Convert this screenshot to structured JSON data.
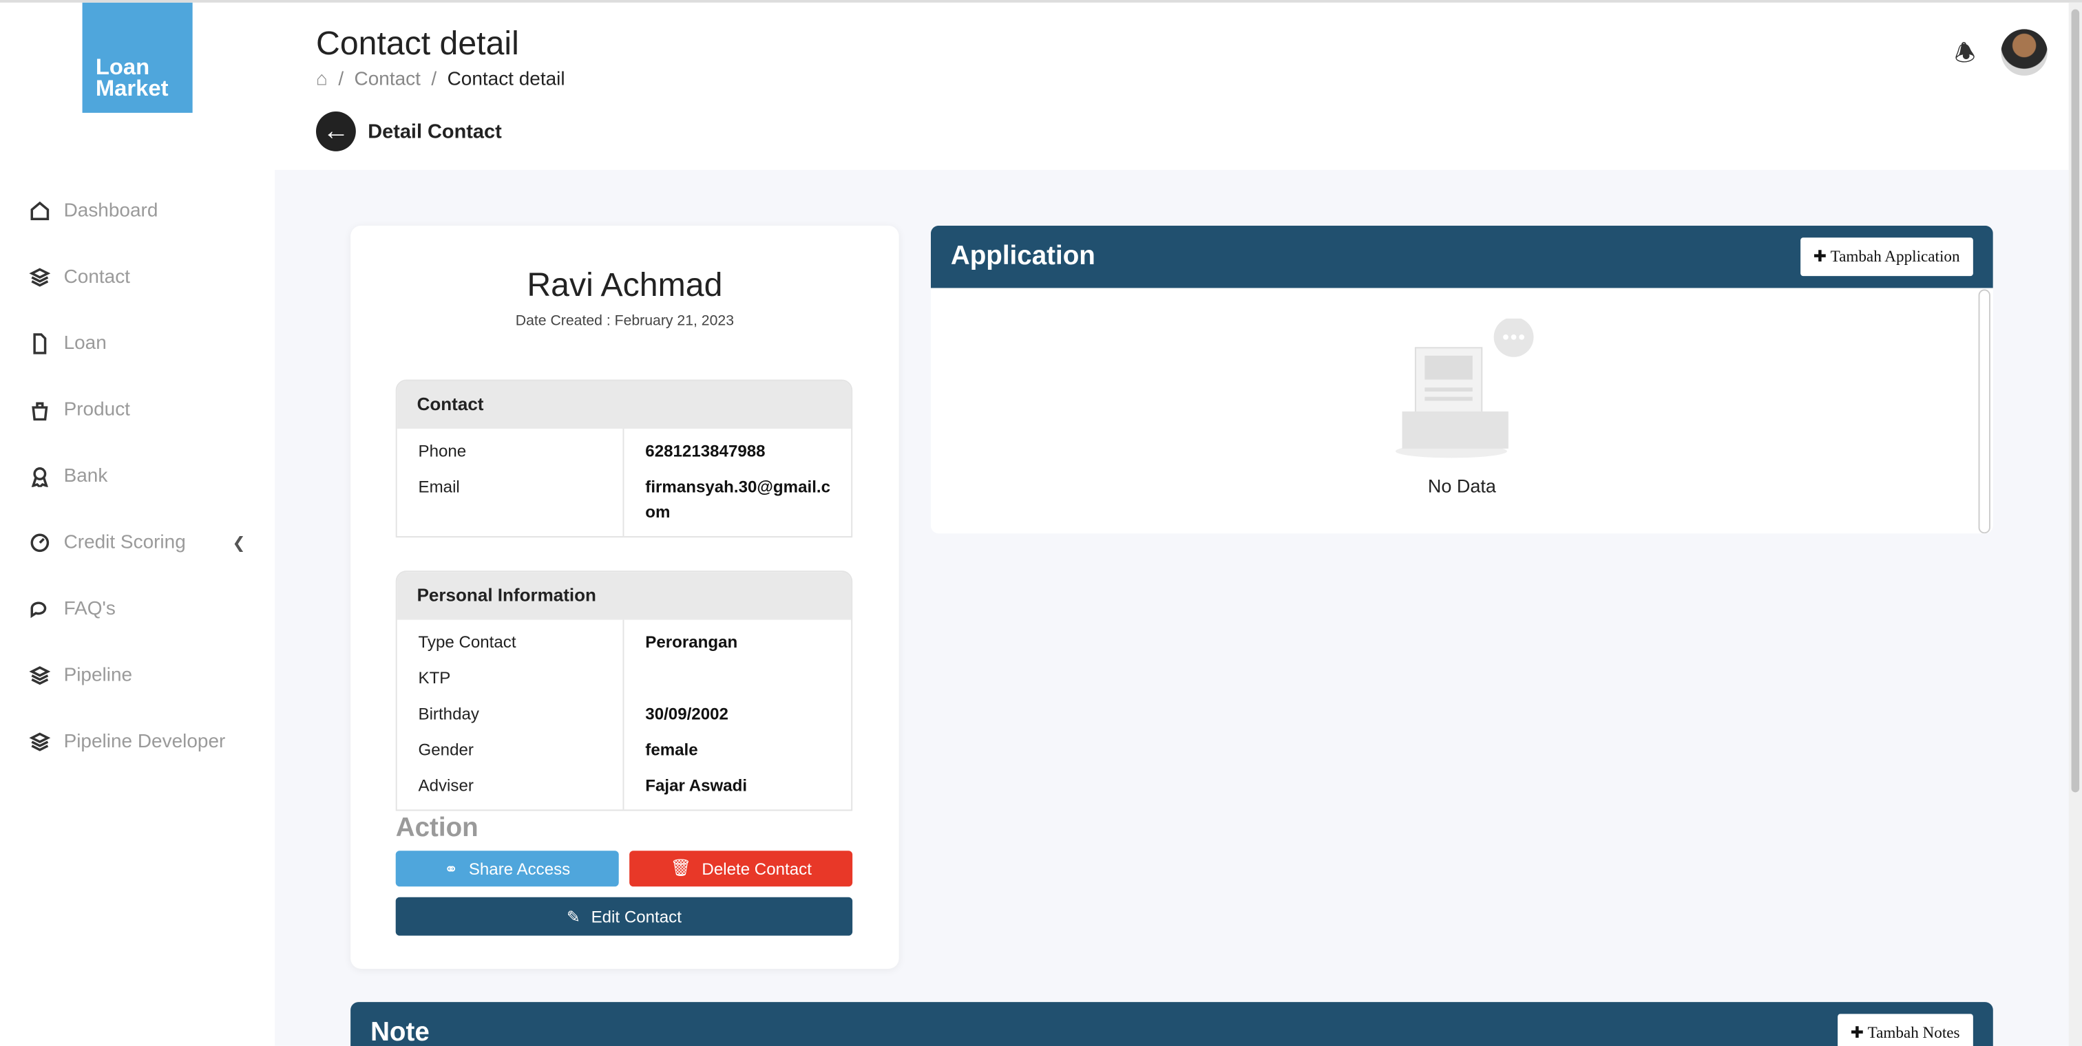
{
  "logo": {
    "line1": "Loan",
    "line2": "Market"
  },
  "nav": [
    {
      "label": "Dashboard"
    },
    {
      "label": "Contact"
    },
    {
      "label": "Loan"
    },
    {
      "label": "Product"
    },
    {
      "label": "Bank"
    },
    {
      "label": "Credit Scoring"
    },
    {
      "label": "FAQ's"
    },
    {
      "label": "Pipeline"
    },
    {
      "label": "Pipeline Developer"
    }
  ],
  "header": {
    "title": "Contact detail",
    "crumb_sep": "/",
    "crumb_contact": "Contact",
    "crumb_current": "Contact detail",
    "back_label": "Detail Contact"
  },
  "contact": {
    "name": "Ravi Achmad",
    "created": "Date Created : February 21, 2023",
    "contact_title": "Contact",
    "phone_label": "Phone",
    "phone": "6281213847988",
    "email_label": "Email",
    "email": "firmansyah.30@gmail.com",
    "personal_title": "Personal Information",
    "type_label": "Type Contact",
    "type": "Perorangan",
    "ktp_label": "KTP",
    "ktp": "",
    "birthday_label": "Birthday",
    "birthday": "30/09/2002",
    "gender_label": "Gender",
    "gender": "female",
    "adviser_label": "Adviser",
    "adviser": "Fajar Aswadi"
  },
  "actions": {
    "title": "Action",
    "share": "Share Access",
    "delete": "Delete Contact",
    "edit": "Edit Contact"
  },
  "application": {
    "title": "Application",
    "add": "Tambah Application",
    "empty": "No Data"
  },
  "note": {
    "title": "Note",
    "add": "Tambah Notes"
  },
  "colors": {
    "primary": "#21506f",
    "share": "#4fa6dc",
    "delete": "#e83828"
  }
}
